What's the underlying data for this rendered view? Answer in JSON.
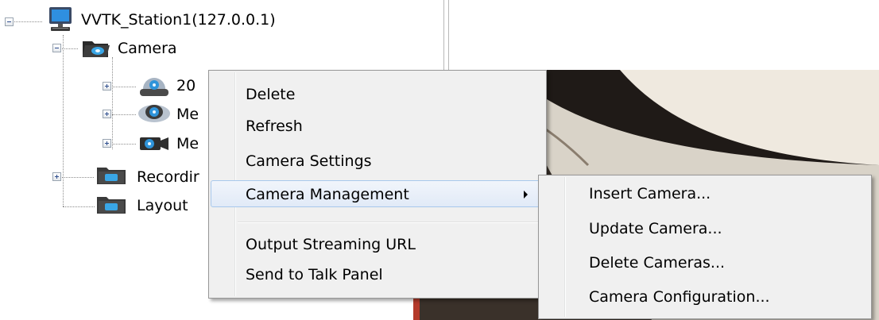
{
  "tree": {
    "station": "VVTK_Station1(127.0.0.1)",
    "camera_group": "Camera",
    "cameras": [
      "20",
      "Me",
      "Me"
    ],
    "recording": "Recordir",
    "layout": "Layout"
  },
  "context_menu": {
    "items": [
      "Delete",
      "Refresh",
      "Camera Settings"
    ],
    "submenu_parent": "Camera Management",
    "bottom_items": [
      "Output Streaming URL",
      "Send to Talk Panel"
    ]
  },
  "submenu": {
    "items": [
      "Insert Camera...",
      "Update Camera...",
      "Delete Cameras...",
      "Camera Configuration..."
    ]
  },
  "icons": {
    "station": "computer-monitor-icon",
    "camera_group": "open-folder-camera-icon",
    "camera_1": "dome-camera-icon",
    "camera_2": "fisheye-camera-icon",
    "camera_3": "box-camera-icon",
    "recording": "folder-icon",
    "layout": "folder-icon",
    "submenu_arrow": "chevron-right-icon"
  }
}
